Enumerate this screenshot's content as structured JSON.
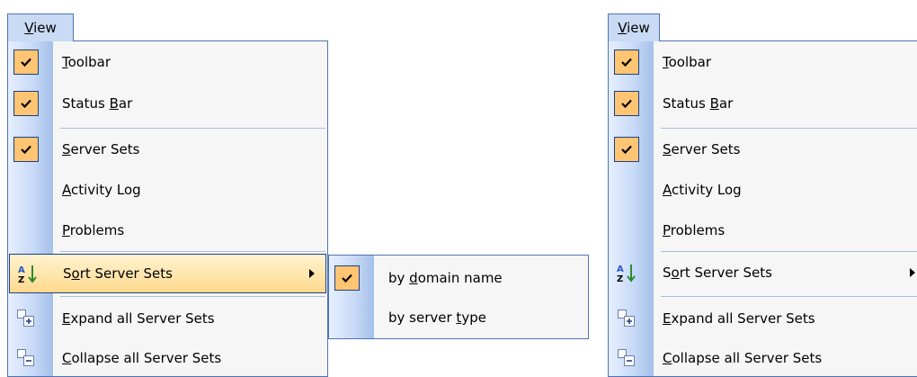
{
  "menu": {
    "title": "View",
    "items": {
      "toolbar": "Toolbar",
      "status_bar": "Status Bar",
      "server_sets": "Server Sets",
      "activity_log": "Activity Log",
      "problems": "Problems",
      "sort_server_sets": "Sort Server Sets",
      "expand_all": "Expand all Server Sets",
      "collapse_all": "Collapse all Server Sets"
    },
    "checked": [
      "Toolbar",
      "Status Bar",
      "Server Sets"
    ]
  },
  "submenu": {
    "items": {
      "by_domain_name": "by domain name",
      "by_server_type": "by server type"
    },
    "checked": [
      "by domain name"
    ]
  },
  "colors": {
    "border": "#4f74b3",
    "check_bg": "#ffc572",
    "highlight": "#ffd98d",
    "gutter": "#c8daf7"
  },
  "icons": [
    "checkmark-icon",
    "sort-az-icon",
    "expand-all-icon",
    "collapse-all-icon",
    "submenu-arrow-icon"
  ]
}
